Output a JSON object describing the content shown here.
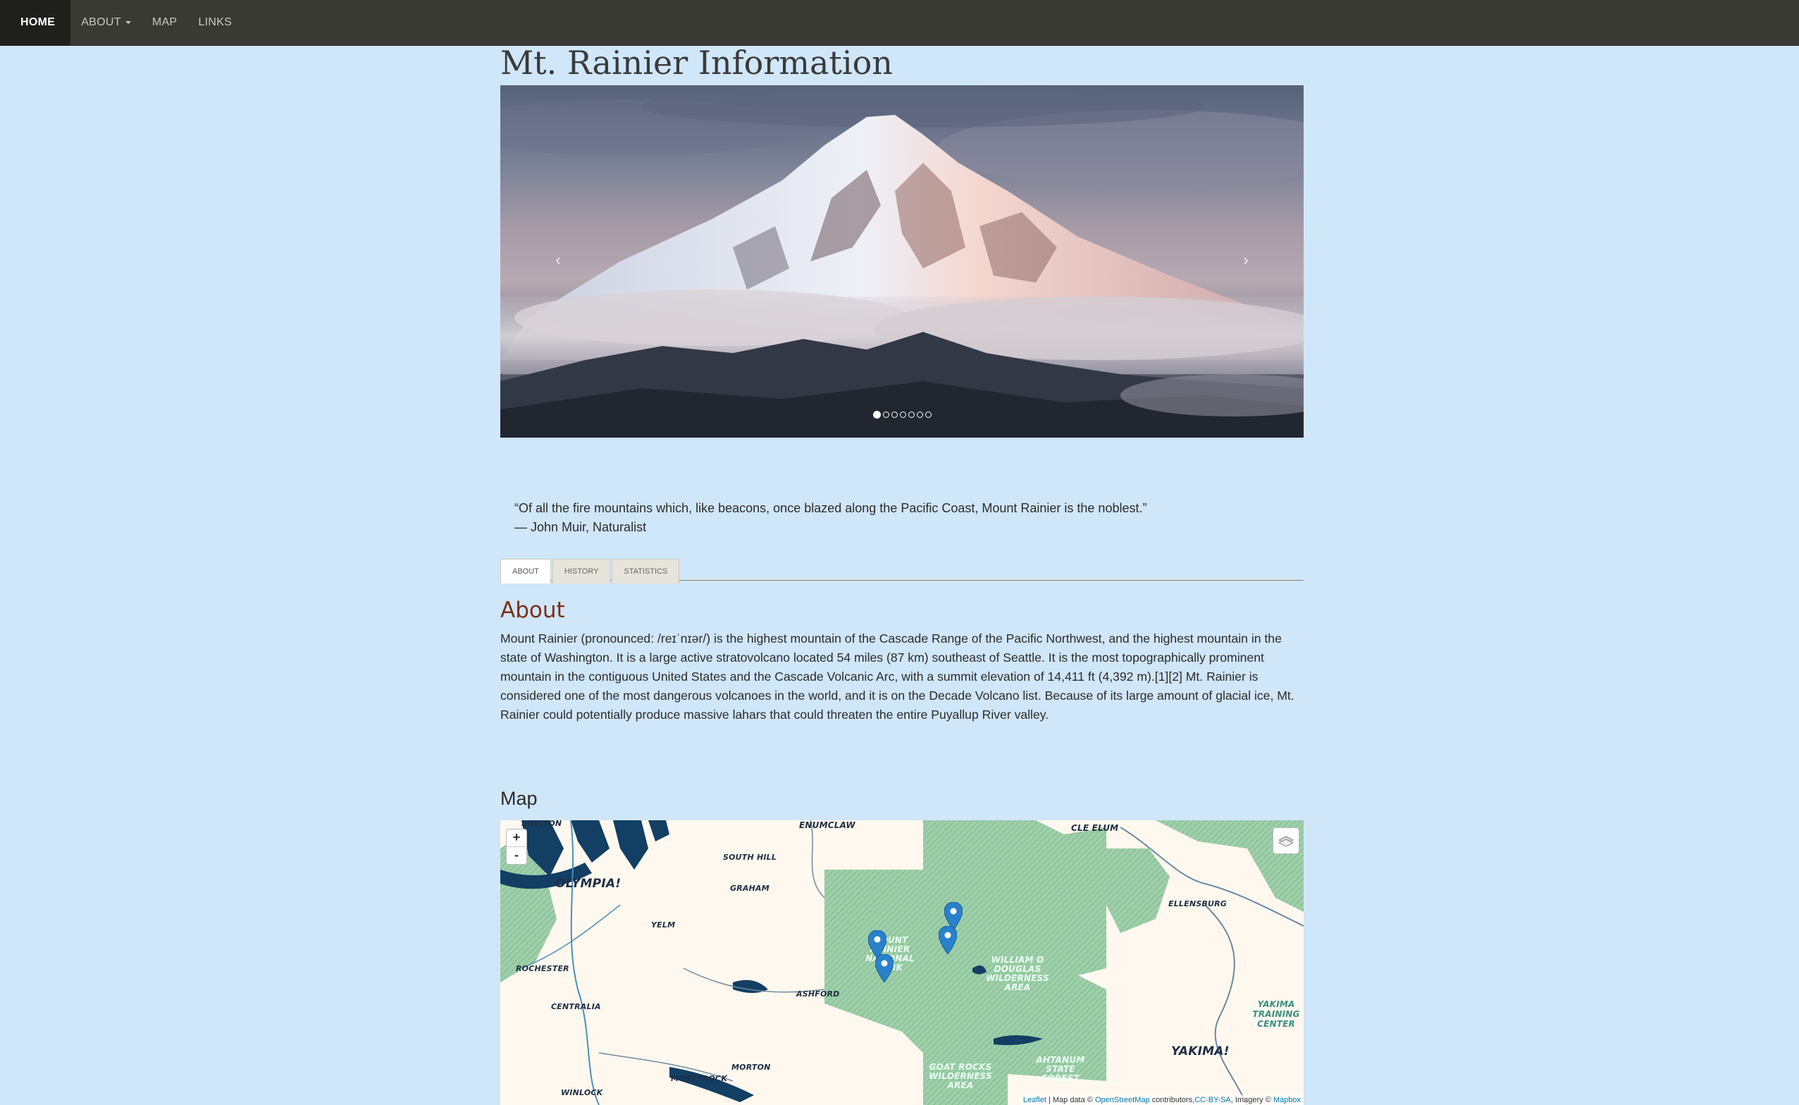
{
  "navbar": {
    "home": "HOME",
    "about": "ABOUT",
    "map": "MAP",
    "links": "LINKS"
  },
  "page_title": "Mt. Rainier Information",
  "carousel": {
    "prev": "‹",
    "next": "›",
    "slide_count": 7,
    "active_slide": 1
  },
  "quote": {
    "text": "“Of all the fire mountains which, like beacons, once blazed along the Pacific Coast, Mount Rainier is the noblest.”",
    "author": "— John Muir, Naturalist"
  },
  "tabs": [
    "ABOUT",
    "HISTORY",
    "STATISTICS"
  ],
  "about": {
    "title": "About",
    "text": "Mount Rainier (pronounced: /reɪˈnɪər/) is the highest mountain of the Cascade Range of the Pacific Northwest, and the highest mountain in the state of Washington. It is a large active stratovolcano located 54 miles (87 km) southeast of Seattle. It is the most topographically prominent mountain in the contiguous United States and the Cascade Volcanic Arc, with a summit elevation of 14,411 ft (4,392 m).[1][2] Mt. Rainier is considered one of the most dangerous volcanoes in the world, and it is on the Decade Volcano list. Because of its large amount of glacial ice, Mt. Rainier could potentially produce massive lahars that could threaten the entire Puyallup River valley."
  },
  "map": {
    "title": "Map",
    "zoom_in": "+",
    "zoom_out": "-",
    "labels": {
      "shelton": "SHELTON",
      "enumclaw": "ENUMCLAW",
      "cle_elum": "CLE ELUM",
      "olympia": "OLYMPIA!",
      "south_hill": "SOUTH HILL",
      "graham": "GRAHAM",
      "yelm": "YELM",
      "ellensburg": "ELLENSBURG",
      "rochester": "ROCHESTER",
      "centralia": "CENTRALIA",
      "ashford": "ASHFORD",
      "morton": "MORTON",
      "mossyrock": "MOSSYROCK",
      "winlock": "WINLOCK",
      "yakima": "YAKIMA!",
      "rainier_np": "MOUNT RAINIER NATIONAL PARK",
      "william_o_douglas": "WILLIAM O DOUGLAS WILDERNESS AREA",
      "goat_rocks": "GOAT ROCKS WILDERNESS AREA",
      "ahtanum": "AHTANUM STATE FOREST",
      "yakima_training": "YAKIMA TRAINING CENTER"
    },
    "attribution": {
      "leaflet": "Leaflet",
      "text1": "| Map data ©",
      "osm": "OpenStreetMap",
      "text2": "contributors,",
      "license": "CC-BY-SA",
      "text3": ", Imagery ©",
      "mapbox": "Mapbox"
    },
    "marker_color": "#2a81cb"
  },
  "colors": {
    "background": "#d0e6f9",
    "navbar": "#3a3a35",
    "about_heading": "#7b2f18"
  }
}
